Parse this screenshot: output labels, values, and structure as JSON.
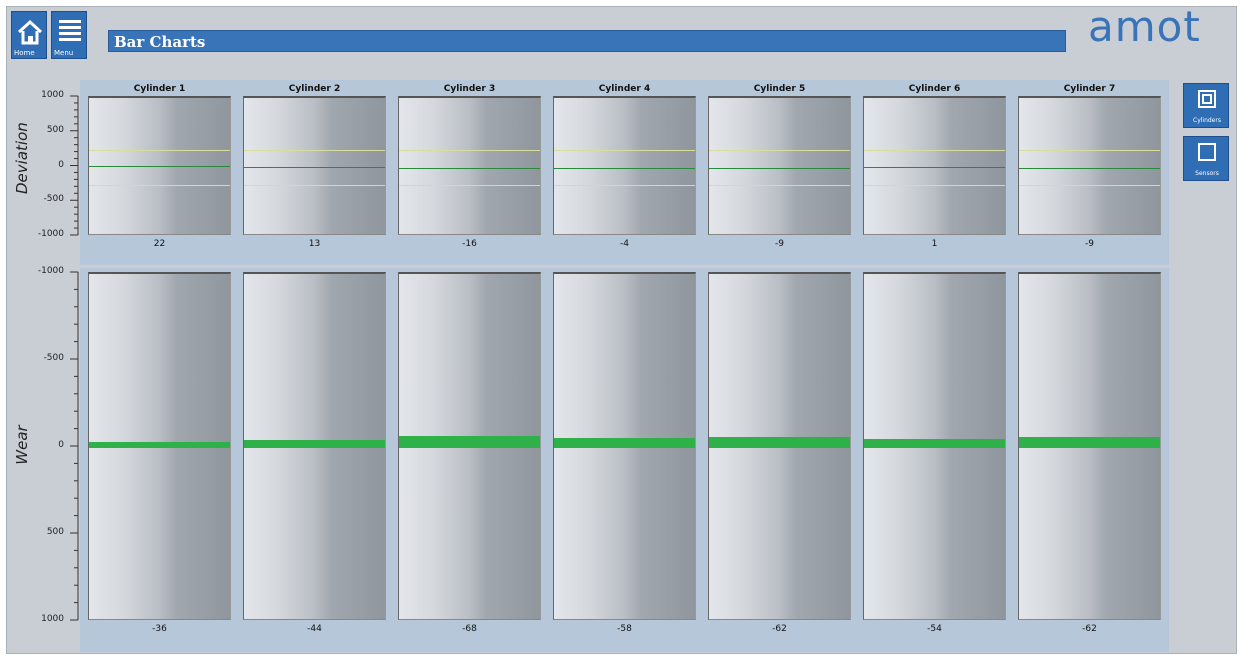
{
  "header": {
    "home_label": "Home",
    "menu_label": "Menu",
    "title": "Bar Charts",
    "logo": "amot"
  },
  "sidebar": {
    "cylinders_label": "Cylinders",
    "sensors_label": "Sensors"
  },
  "colors": {
    "accent": "#3a74b8",
    "bar": "#2fb14a",
    "zero_line": "#2a8a3a",
    "limit_line": "#d8dd9a"
  },
  "chart_data": [
    {
      "type": "bar",
      "ylabel": "Deviation",
      "categories": [
        "Cylinder 1",
        "Cylinder 2",
        "Cylinder 3",
        "Cylinder 4",
        "Cylinder 5",
        "Cylinder 6",
        "Cylinder 7"
      ],
      "values": [
        22,
        13,
        -16,
        -4,
        -9,
        1,
        -9
      ],
      "ylim": [
        -1000,
        1000
      ],
      "yticks": [
        "1000",
        "500",
        "0",
        "-500",
        "-1000"
      ],
      "limits": [
        250,
        -250
      ]
    },
    {
      "type": "bar",
      "ylabel": "Wear",
      "categories": [
        "Cylinder 1",
        "Cylinder 2",
        "Cylinder 3",
        "Cylinder 4",
        "Cylinder 5",
        "Cylinder 6",
        "Cylinder 7"
      ],
      "values": [
        -36,
        -44,
        -68,
        -58,
        -62,
        -54,
        -62
      ],
      "ylim": [
        -1000,
        1000
      ],
      "inverted": true,
      "yticks": [
        "-1000",
        "-500",
        "0",
        "500",
        "1000"
      ]
    }
  ]
}
